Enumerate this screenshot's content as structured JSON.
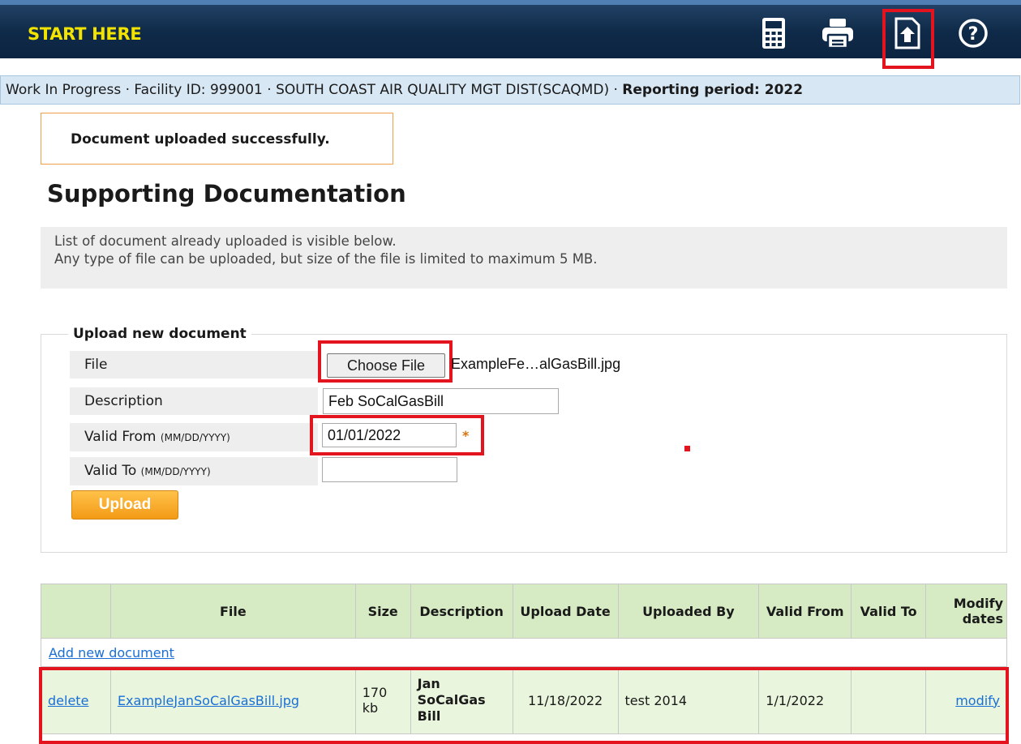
{
  "header": {
    "start_label": "START HERE",
    "icons": [
      "calculator-icon",
      "printer-icon",
      "upload-icon",
      "help-icon"
    ]
  },
  "infobar": {
    "status": "Work In Progress",
    "facility": "Facility ID: 999001",
    "agency": "SOUTH COAST AIR QUALITY MGT DIST(SCAQMD)",
    "period": "Reporting period: 2022",
    "sep": " · "
  },
  "notice": {
    "message": "Document uploaded successfully."
  },
  "page": {
    "title": "Supporting Documentation",
    "info_line1": "List of document already uploaded is visible below.",
    "info_line2": "Any type of file can be uploaded, but size of the file is limited to maximum 5 MB."
  },
  "upload_form": {
    "legend": "Upload new document",
    "file_label": "File",
    "choose_file_label": "Choose File",
    "chosen_file_name": "ExampleFe…alGasBill.jpg",
    "description_label": "Description",
    "description_value": "Feb SoCalGasBill",
    "valid_from_label": "Valid From",
    "valid_from_hint": "(MM/DD/YYYY)",
    "valid_from_value": "01/01/2022",
    "required_mark": "*",
    "valid_to_label": "Valid To",
    "valid_to_hint": "(MM/DD/YYYY)",
    "valid_to_value": "",
    "upload_button": "Upload"
  },
  "documents_table": {
    "headers": [
      "",
      "File",
      "Size",
      "Description",
      "Upload Date",
      "Uploaded By",
      "Valid From",
      "Valid To",
      "Modify dates"
    ],
    "add_link": "Add new document",
    "rows": [
      {
        "delete": "delete",
        "file": "ExampleJanSoCalGasBill.jpg",
        "size": "170 kb",
        "description": "Jan SoCalGas Bill",
        "upload_date": "11/18/2022",
        "uploaded_by": "test 2014",
        "valid_from": "1/1/2022",
        "valid_to": "",
        "modify": "modify"
      }
    ]
  },
  "colors": {
    "header_bg": "#0f2a48",
    "accent_yellow": "#f2e400",
    "highlight_red": "#e3141e",
    "table_header": "#d6ebc3",
    "row_bg": "#e9f5dc"
  }
}
